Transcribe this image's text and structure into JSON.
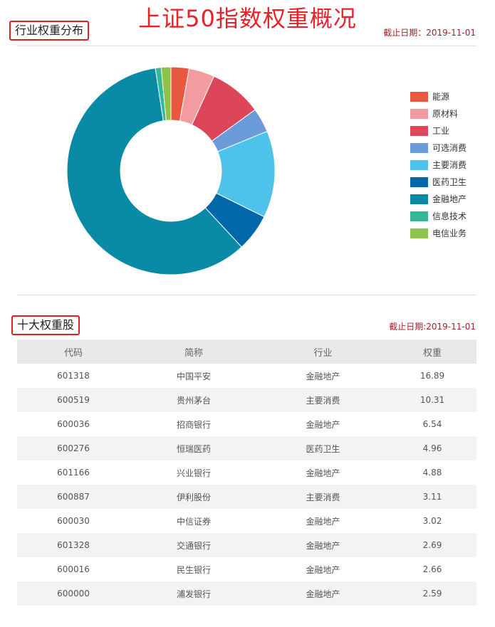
{
  "page": {
    "main_title": "上证50指数权重概况",
    "as_of_1": "截止日期：2019-11-01",
    "as_of_2": "截止日期:2019-11-01"
  },
  "sections": {
    "industry_title": "行业权重分布",
    "top10_title": "十大权重股"
  },
  "colors": {
    "title_red": "#e8212b",
    "box_red": "#e02020",
    "date_red": "#a0252a"
  },
  "chart_data": {
    "type": "pie",
    "donut": true,
    "grid": false,
    "legend_position": "right",
    "categories": [
      "能源",
      "原材料",
      "工业",
      "可选消费",
      "主要消费",
      "医药卫生",
      "金融地产",
      "信息技术",
      "电信业务"
    ],
    "values": [
      2.8,
      4.0,
      8.2,
      3.8,
      13.5,
      5.8,
      59.5,
      0.9,
      1.5
    ],
    "colors": [
      "#e9573f",
      "#f39c9f",
      "#dd4558",
      "#6b9bd8",
      "#4dc3ec",
      "#0068a8",
      "#0a8ba5",
      "#34b898",
      "#8cc54a"
    ],
    "title": ""
  },
  "table": {
    "headers": [
      "代码",
      "简称",
      "行业",
      "权重"
    ],
    "rows": [
      [
        "601318",
        "中国平安",
        "金融地产",
        "16.89"
      ],
      [
        "600519",
        "贵州茅台",
        "主要消费",
        "10.31"
      ],
      [
        "600036",
        "招商银行",
        "金融地产",
        "6.54"
      ],
      [
        "600276",
        "恒瑞医药",
        "医药卫生",
        "4.96"
      ],
      [
        "601166",
        "兴业银行",
        "金融地产",
        "4.88"
      ],
      [
        "600887",
        "伊利股份",
        "主要消费",
        "3.11"
      ],
      [
        "600030",
        "中信证券",
        "金融地产",
        "3.02"
      ],
      [
        "601328",
        "交通银行",
        "金融地产",
        "2.69"
      ],
      [
        "600016",
        "民生银行",
        "金融地产",
        "2.66"
      ],
      [
        "600000",
        "浦发银行",
        "金融地产",
        "2.59"
      ]
    ]
  }
}
